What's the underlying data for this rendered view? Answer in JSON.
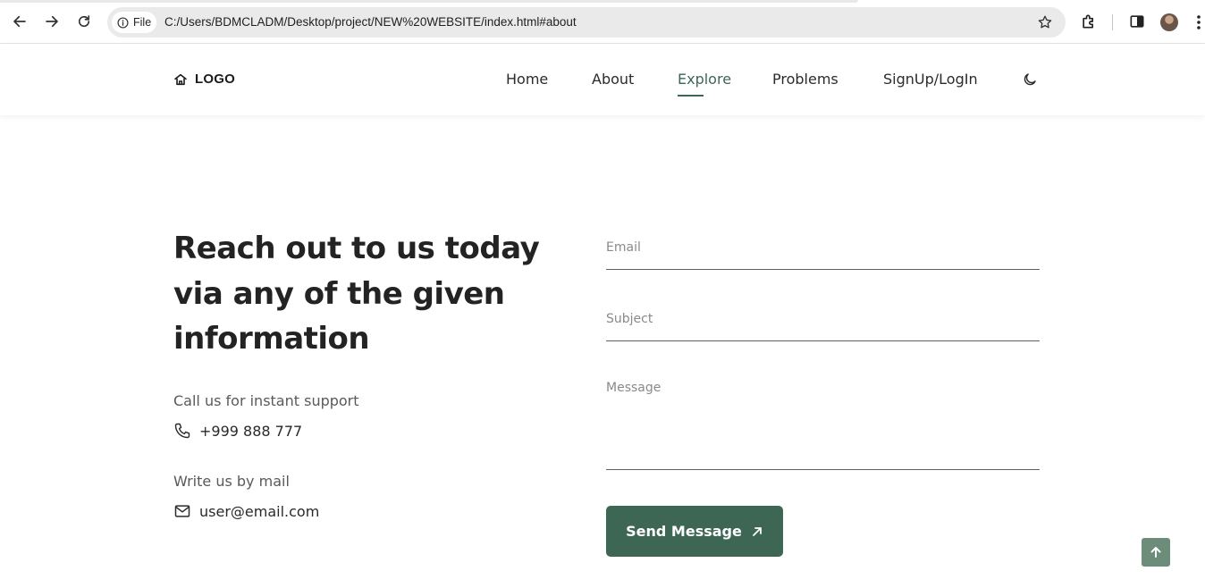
{
  "browser": {
    "site_info_label": "File",
    "url": "C:/Users/BDMCLADM/Desktop/project/NEW%20WEBSITE/index.html#about",
    "icons": [
      "back-arrow-icon",
      "forward-arrow-icon",
      "reload-icon",
      "info-icon",
      "bookmark-star-icon",
      "extensions-icon",
      "side-panel-icon",
      "profile-avatar",
      "kebab-menu-icon"
    ]
  },
  "header": {
    "logo_text": "LOGO",
    "logo_icon": "home-icon",
    "nav": [
      "Home",
      "About",
      "Explore",
      "Problems",
      "SignUp/LogIn"
    ],
    "active_item": "Explore",
    "theme_toggle_icon": "moon-icon"
  },
  "contact": {
    "headline_lines": [
      "Reach out to us today",
      "via any of the given",
      "information"
    ],
    "call_label": "Call us for instant support",
    "phone": "+999 888 777",
    "mail_label": "Write us by mail",
    "email": "user@email.com"
  },
  "form": {
    "email_placeholder": "Email",
    "subject_placeholder": "Subject",
    "message_placeholder": "Message",
    "submit_label": "Send Message"
  },
  "colors": {
    "accent": "#3e6655",
    "scroll_top_button": "#6b8d7a"
  }
}
